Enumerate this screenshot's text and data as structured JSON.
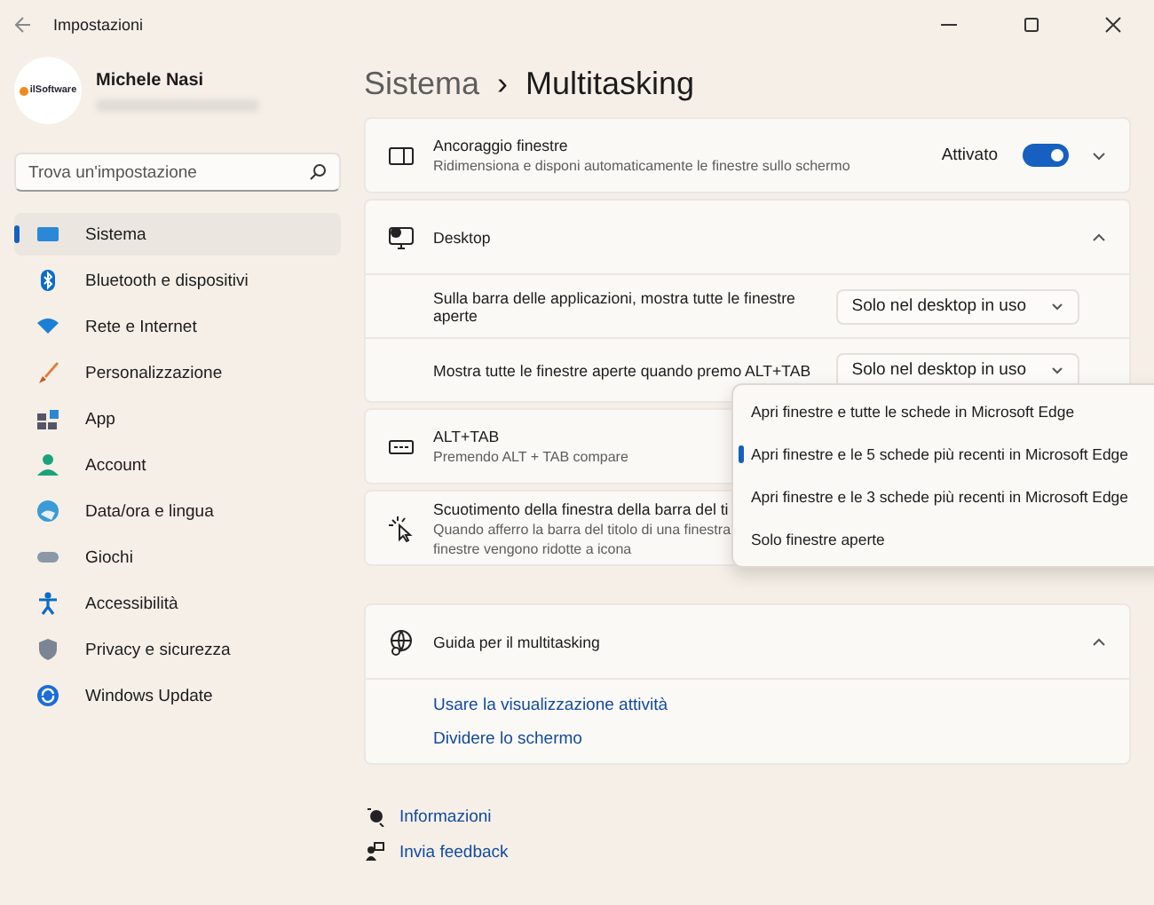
{
  "window": {
    "title": "Impostazioni"
  },
  "profile": {
    "name": "Michele Nasi",
    "avatar_text": "ilSoftware"
  },
  "search": {
    "placeholder": "Trova un'impostazione"
  },
  "nav": [
    {
      "label": "Sistema",
      "selected": true,
      "kind": "system"
    },
    {
      "label": "Bluetooth e dispositivi",
      "selected": false,
      "kind": "bluetooth"
    },
    {
      "label": "Rete e Internet",
      "selected": false,
      "kind": "network"
    },
    {
      "label": "Personalizzazione",
      "selected": false,
      "kind": "brush"
    },
    {
      "label": "App",
      "selected": false,
      "kind": "apps"
    },
    {
      "label": "Account",
      "selected": false,
      "kind": "account"
    },
    {
      "label": "Data/ora e lingua",
      "selected": false,
      "kind": "globe"
    },
    {
      "label": "Giochi",
      "selected": false,
      "kind": "games"
    },
    {
      "label": "Accessibilità",
      "selected": false,
      "kind": "access"
    },
    {
      "label": "Privacy e sicurezza",
      "selected": false,
      "kind": "shield"
    },
    {
      "label": "Windows Update",
      "selected": false,
      "kind": "update"
    }
  ],
  "breadcrumb": {
    "parent": "Sistema",
    "separator": "›",
    "current": "Multitasking"
  },
  "sections": [
    {
      "kind": "toggle",
      "title": "Ancoraggio finestre",
      "description": [
        "Ridimensiona e disponi automaticamente le finestre sullo schermo"
      ],
      "state_label": "Attivato",
      "on": true,
      "expanded": false
    },
    {
      "kind": "group",
      "title": "Desktop",
      "expanded": true,
      "rows": [
        {
          "label": "Sulla barra delle applicazioni, mostra tutte le finestre aperte",
          "value": "Solo nel desktop in uso"
        },
        {
          "label": "Mostra tutte le finestre aperte quando premo ALT+TAB",
          "value": "Solo nel desktop in uso"
        }
      ]
    },
    {
      "kind": "setting",
      "title": "ALT+TAB",
      "description": [
        "Premendo ALT + TAB compare"
      ]
    },
    {
      "kind": "setting",
      "title": "Scuotimento della finestra della barra del ti",
      "description": [
        "Quando afferro la barra del titolo di una finestra",
        "finestre vengono ridotte a icona"
      ]
    }
  ],
  "help": {
    "title": "Guida per il multitasking",
    "expanded": true,
    "links": [
      "Usare la visualizzazione attività",
      "Dividere lo schermo"
    ]
  },
  "footer_links": [
    {
      "label": "Informazioni",
      "kind": "info"
    },
    {
      "label": "Invia feedback",
      "kind": "feedback"
    }
  ],
  "dropdown_menu": {
    "items": [
      {
        "label": "Apri finestre e tutte le schede in Microsoft Edge",
        "selected": false
      },
      {
        "label": "Apri finestre e le 5 schede più recenti in Microsoft Edge",
        "selected": true
      },
      {
        "label": "Apri finestre e le 3 schede più recenti in Microsoft Edge",
        "selected": false
      },
      {
        "label": "Solo finestre aperte",
        "selected": false
      }
    ]
  }
}
